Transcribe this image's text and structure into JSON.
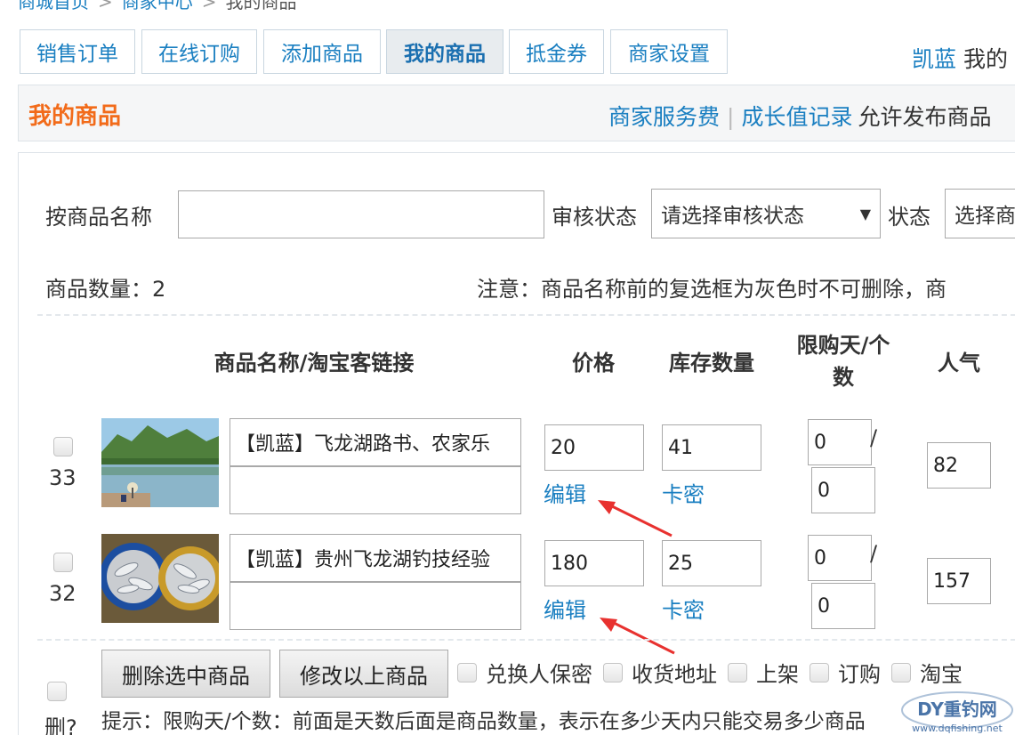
{
  "breadcrumb": {
    "home": "商城首页",
    "center": "商家中心",
    "current": "我的商品",
    "sep": ">"
  },
  "tabs": [
    {
      "label": "销售订单"
    },
    {
      "label": "在线订购"
    },
    {
      "label": "添加商品"
    },
    {
      "label": "我的商品",
      "active": true
    },
    {
      "label": "抵金券"
    },
    {
      "label": "商家设置"
    }
  ],
  "user": {
    "name": "凯蓝",
    "rest": "我的"
  },
  "header": {
    "title": "我的商品",
    "service_fee": "商家服务费",
    "growth": "成长值记录",
    "allow": "允许发布商品"
  },
  "filters": {
    "name_label": "按商品名称",
    "name_value": "",
    "audit_label": "审核状态",
    "audit_selected": "请选择审核状态",
    "status_label": "状态",
    "status_selected": "选择商"
  },
  "summary": {
    "count": "商品数量：2",
    "note": "注意：商品名称前的复选框为灰色时不可删除，商"
  },
  "columns": {
    "name": "商品名称/淘宝客链接",
    "price": "价格",
    "stock": "库存数量",
    "limit_1": "限购天/个",
    "limit_2": "数",
    "popularity": "人气"
  },
  "products": [
    {
      "id": "33",
      "name": "【凯蓝】飞龙湖路书、农家乐",
      "link": "",
      "price": "20",
      "edit": "编辑",
      "stock": "41",
      "card": "卡密",
      "limit_days": "0",
      "limit_count": "0",
      "slash": "/",
      "popularity": "82"
    },
    {
      "id": "32",
      "name": "【凯蓝】贵州飞龙湖钓技经验",
      "link": "",
      "price": "180",
      "edit": "编辑",
      "stock": "25",
      "card": "卡密",
      "limit_days": "0",
      "limit_count": "0",
      "slash": "/",
      "popularity": "157"
    }
  ],
  "footer": {
    "delete_selected": "删除选中商品",
    "modify": "修改以上商品",
    "del_label": "删?",
    "options": [
      "兑换人保密",
      "收货地址",
      "上架",
      "订购",
      "淘宝"
    ],
    "tip": "提示：限购天/个数：前面是天数后面是商品数量，表示在多少天内只能交易多少商品"
  },
  "watermark": {
    "brand": "DY重钓网",
    "url": "www.dqfishing.net"
  },
  "colors": {
    "accent": "#1a7fc1",
    "title": "#f26b1a",
    "arrow": "#e8312f"
  }
}
